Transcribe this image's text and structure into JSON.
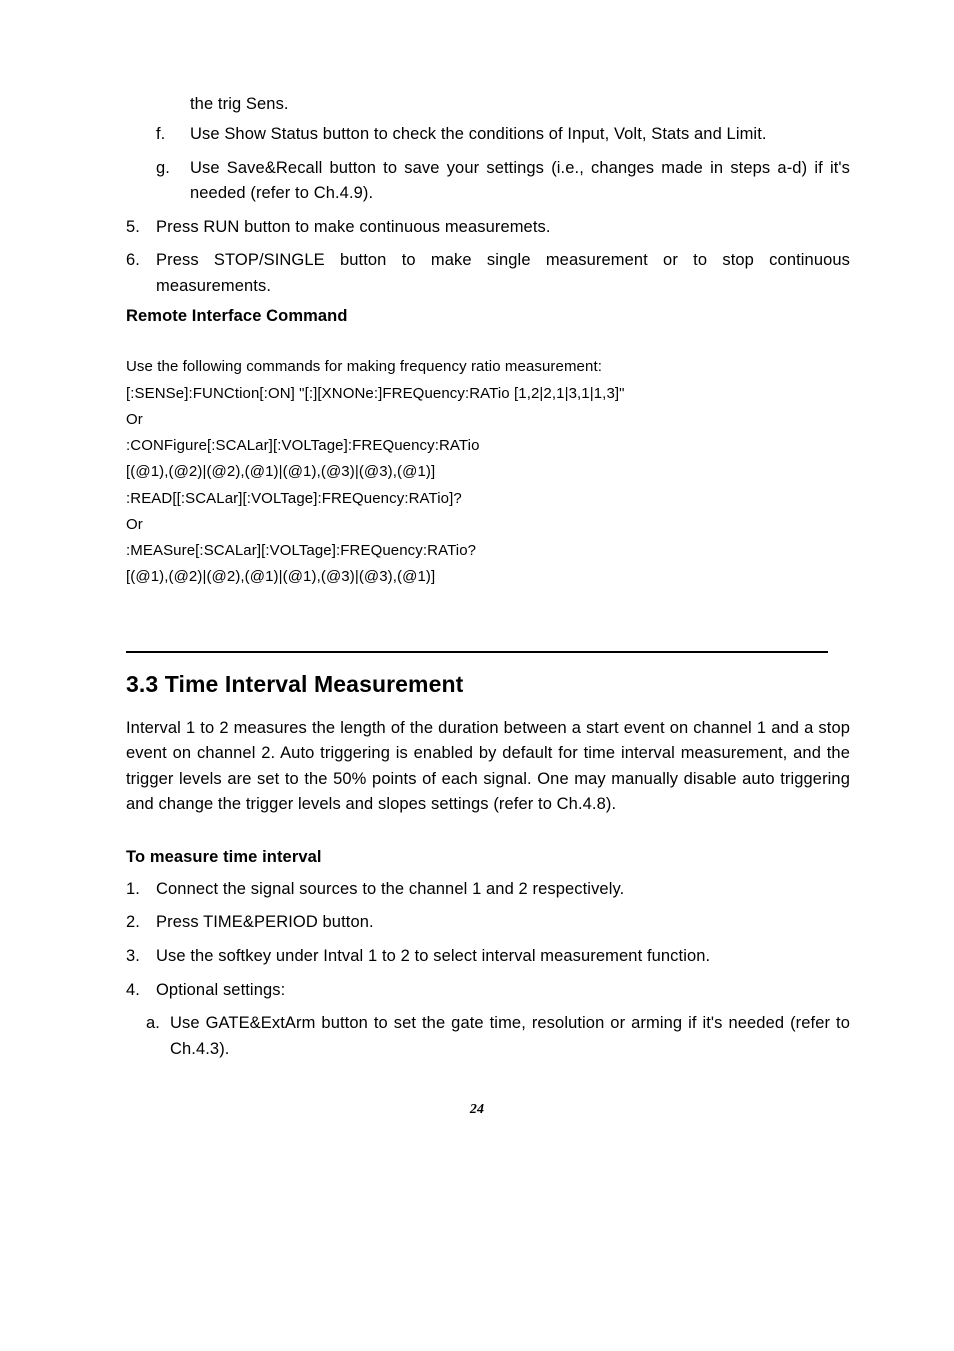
{
  "cont_line": "the trig Sens.",
  "alpha_f": {
    "marker": "f.",
    "text": "Use Show Status button to check the conditions of Input, Volt, Stats and Limit."
  },
  "alpha_g": {
    "marker": "g.",
    "text": "Use Save&Recall button to save your settings (i.e., changes made in steps a-d) if it's needed (refer to Ch.4.9)."
  },
  "num_5": {
    "marker": "5.",
    "text": "Press RUN button to make continuous measuremets."
  },
  "num_6": {
    "marker": "6.",
    "text": "Press STOP/SINGLE button to make single measurement or to stop continuous measurements."
  },
  "remote_heading": "Remote Interface Command",
  "code": {
    "l1": "Use the following commands for making frequency ratio measurement:",
    "l2": "[:SENSe]:FUNCtion[:ON] \"[:][XNONe:]FREQuency:RATio [1,2|2,1|3,1|1,3]\"",
    "l3": "Or",
    "l4": ":CONFigure[:SCALar][:VOLTage]:FREQuency:RATio",
    "l5": "[(@1),(@2)|(@2),(@1)|(@1),(@3)|(@3),(@1)]",
    "l6": ":READ[[:SCALar][:VOLTage]:FREQuency:RATio]?",
    "l7": "Or",
    "l8": ":MEASure[:SCALar][:VOLTage]:FREQuency:RATio?",
    "l9": "[(@1),(@2)|(@2),(@1)|(@1),(@3)|(@3),(@1)]"
  },
  "section_heading": "3.3 Time Interval Measurement",
  "section_para": "Interval 1 to 2 measures the length of the duration between a start event on channel 1 and a stop event on channel 2. Auto triggering is enabled by default for time interval measurement, and the trigger levels are set to the 50% points of each signal. One may manually disable auto triggering and change the trigger levels and slopes settings (refer to Ch.4.8).",
  "sub_heading": "To measure time interval",
  "s_num_1": {
    "marker": "1.",
    "text": "Connect the signal sources to the channel 1 and 2 respectively."
  },
  "s_num_2": {
    "marker": "2.",
    "text": "Press TIME&PERIOD button."
  },
  "s_num_3": {
    "marker": "3.",
    "text": "Use the softkey under Intval 1 to 2 to select interval measurement function."
  },
  "s_num_4": {
    "marker": "4.",
    "text": "Optional settings:"
  },
  "s_alpha_a": {
    "marker": "a.",
    "text": "Use GATE&ExtArm button to set the gate time, resolution or arming if it's needed (refer to Ch.4.3)."
  },
  "page_number": "24"
}
